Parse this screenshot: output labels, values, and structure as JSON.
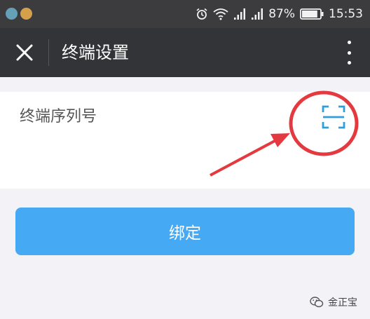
{
  "status_bar": {
    "battery_percent": "87%",
    "battery_level": 0.87,
    "time": "15:53",
    "icons": [
      "gallery-notification-icon",
      "app-notification-icon",
      "alarm-icon",
      "wifi-icon",
      "signal-icon",
      "signal-icon",
      "battery-icon"
    ]
  },
  "toolbar": {
    "title": "终端设置",
    "close_icon": "close-icon",
    "more_icon": "more-vertical-icon"
  },
  "form": {
    "serial_label": "终端序列号",
    "scan_icon": "scan-icon"
  },
  "bind_button": {
    "label": "绑定"
  },
  "watermark": {
    "text": "金正宝"
  },
  "colors": {
    "status_bar": "#3c3c3e",
    "toolbar": "#333437",
    "page_background": "#f3f2f7",
    "primary_button": "#46a9f3",
    "scan_icon": "#2f9ed9",
    "annotation": "#e43a3f"
  }
}
